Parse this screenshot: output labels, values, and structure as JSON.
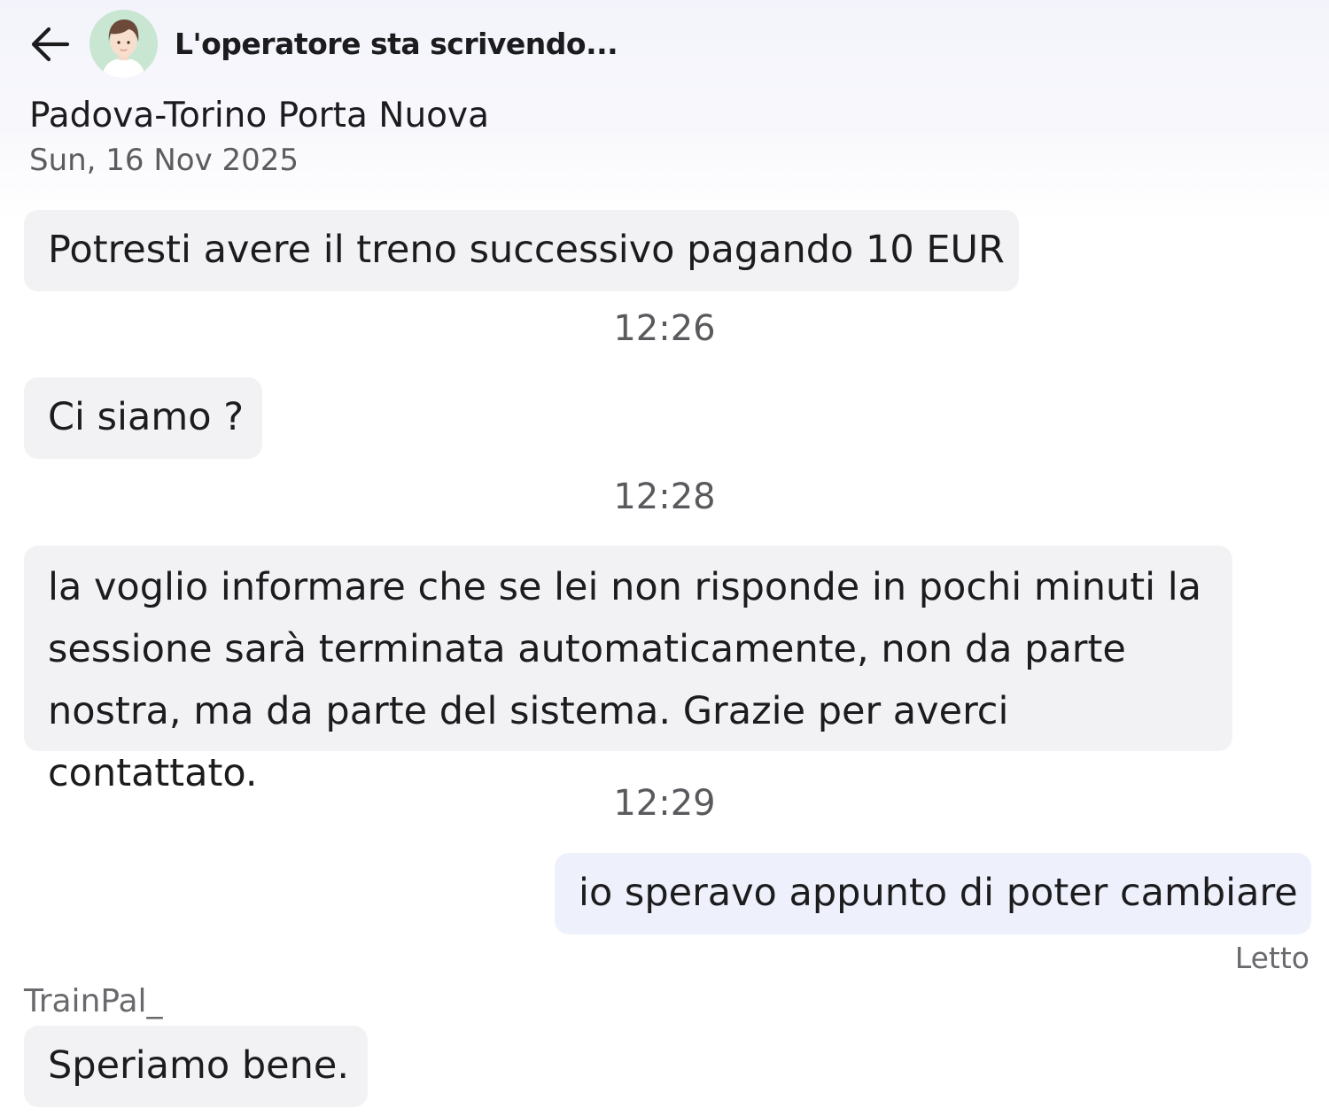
{
  "header": {
    "back_icon": "arrow-left-icon",
    "avatar_icon": "operator-avatar",
    "status": "L'operatore sta scrivendo..."
  },
  "trip": {
    "route": "Padova-Torino Porta Nuova",
    "date": "Sun, 16 Nov 2025"
  },
  "messages": [
    {
      "text": "Potresti avere il treno successivo pagando 10 EUR",
      "from": "agent"
    },
    {
      "text": "Ci siamo ?",
      "from": "agent",
      "time_before": "12:26"
    },
    {
      "text": "la voglio informare che se lei non risponde in pochi minuti la\nsessione sarà terminata automaticamente, non da parte\nnostra, ma da parte del sistema. Grazie per averci contattato.",
      "from": "agent",
      "time_before": "12:28"
    },
    {
      "text": "io speravo appunto di poter cambiare",
      "from": "user",
      "time_before": "12:29",
      "status": "Letto"
    },
    {
      "text": "Speriamo bene.",
      "from": "agent",
      "sender": "TrainPal_"
    }
  ],
  "colors": {
    "agent_bubble": "#f2f2f4",
    "user_bubble": "#eef1fc",
    "avatar_bg": "#c9e6d2"
  }
}
